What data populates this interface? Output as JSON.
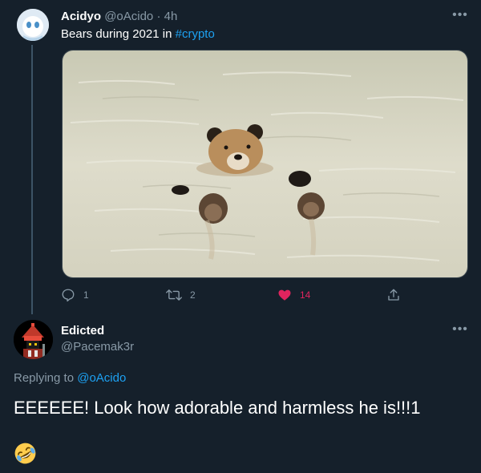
{
  "tweet": {
    "author_name": "Acidyo",
    "author_handle": "@oAcido",
    "time": "· 4h",
    "text": "Bears during 2021 in ",
    "hashtag": "#crypto",
    "more_icon": "more-dots-icon",
    "media_alt": "bear swimming in water",
    "actions": {
      "reply_count": "1",
      "retweet_count": "2",
      "like_count": "14",
      "liked": true
    }
  },
  "reply": {
    "author_name": "Edicted",
    "author_handle": "@Pacemak3r",
    "replying_prefix": "Replying to ",
    "replying_mention": "@oAcido",
    "text": "EEEEEE!  Look how adorable and harmless he is!!!1",
    "emoji": "rolling-on-floor-laughing-emoji"
  },
  "colors": {
    "background": "#15202b",
    "accent": "#1da1f2",
    "like": "#e0245e",
    "muted": "#8899a6"
  }
}
